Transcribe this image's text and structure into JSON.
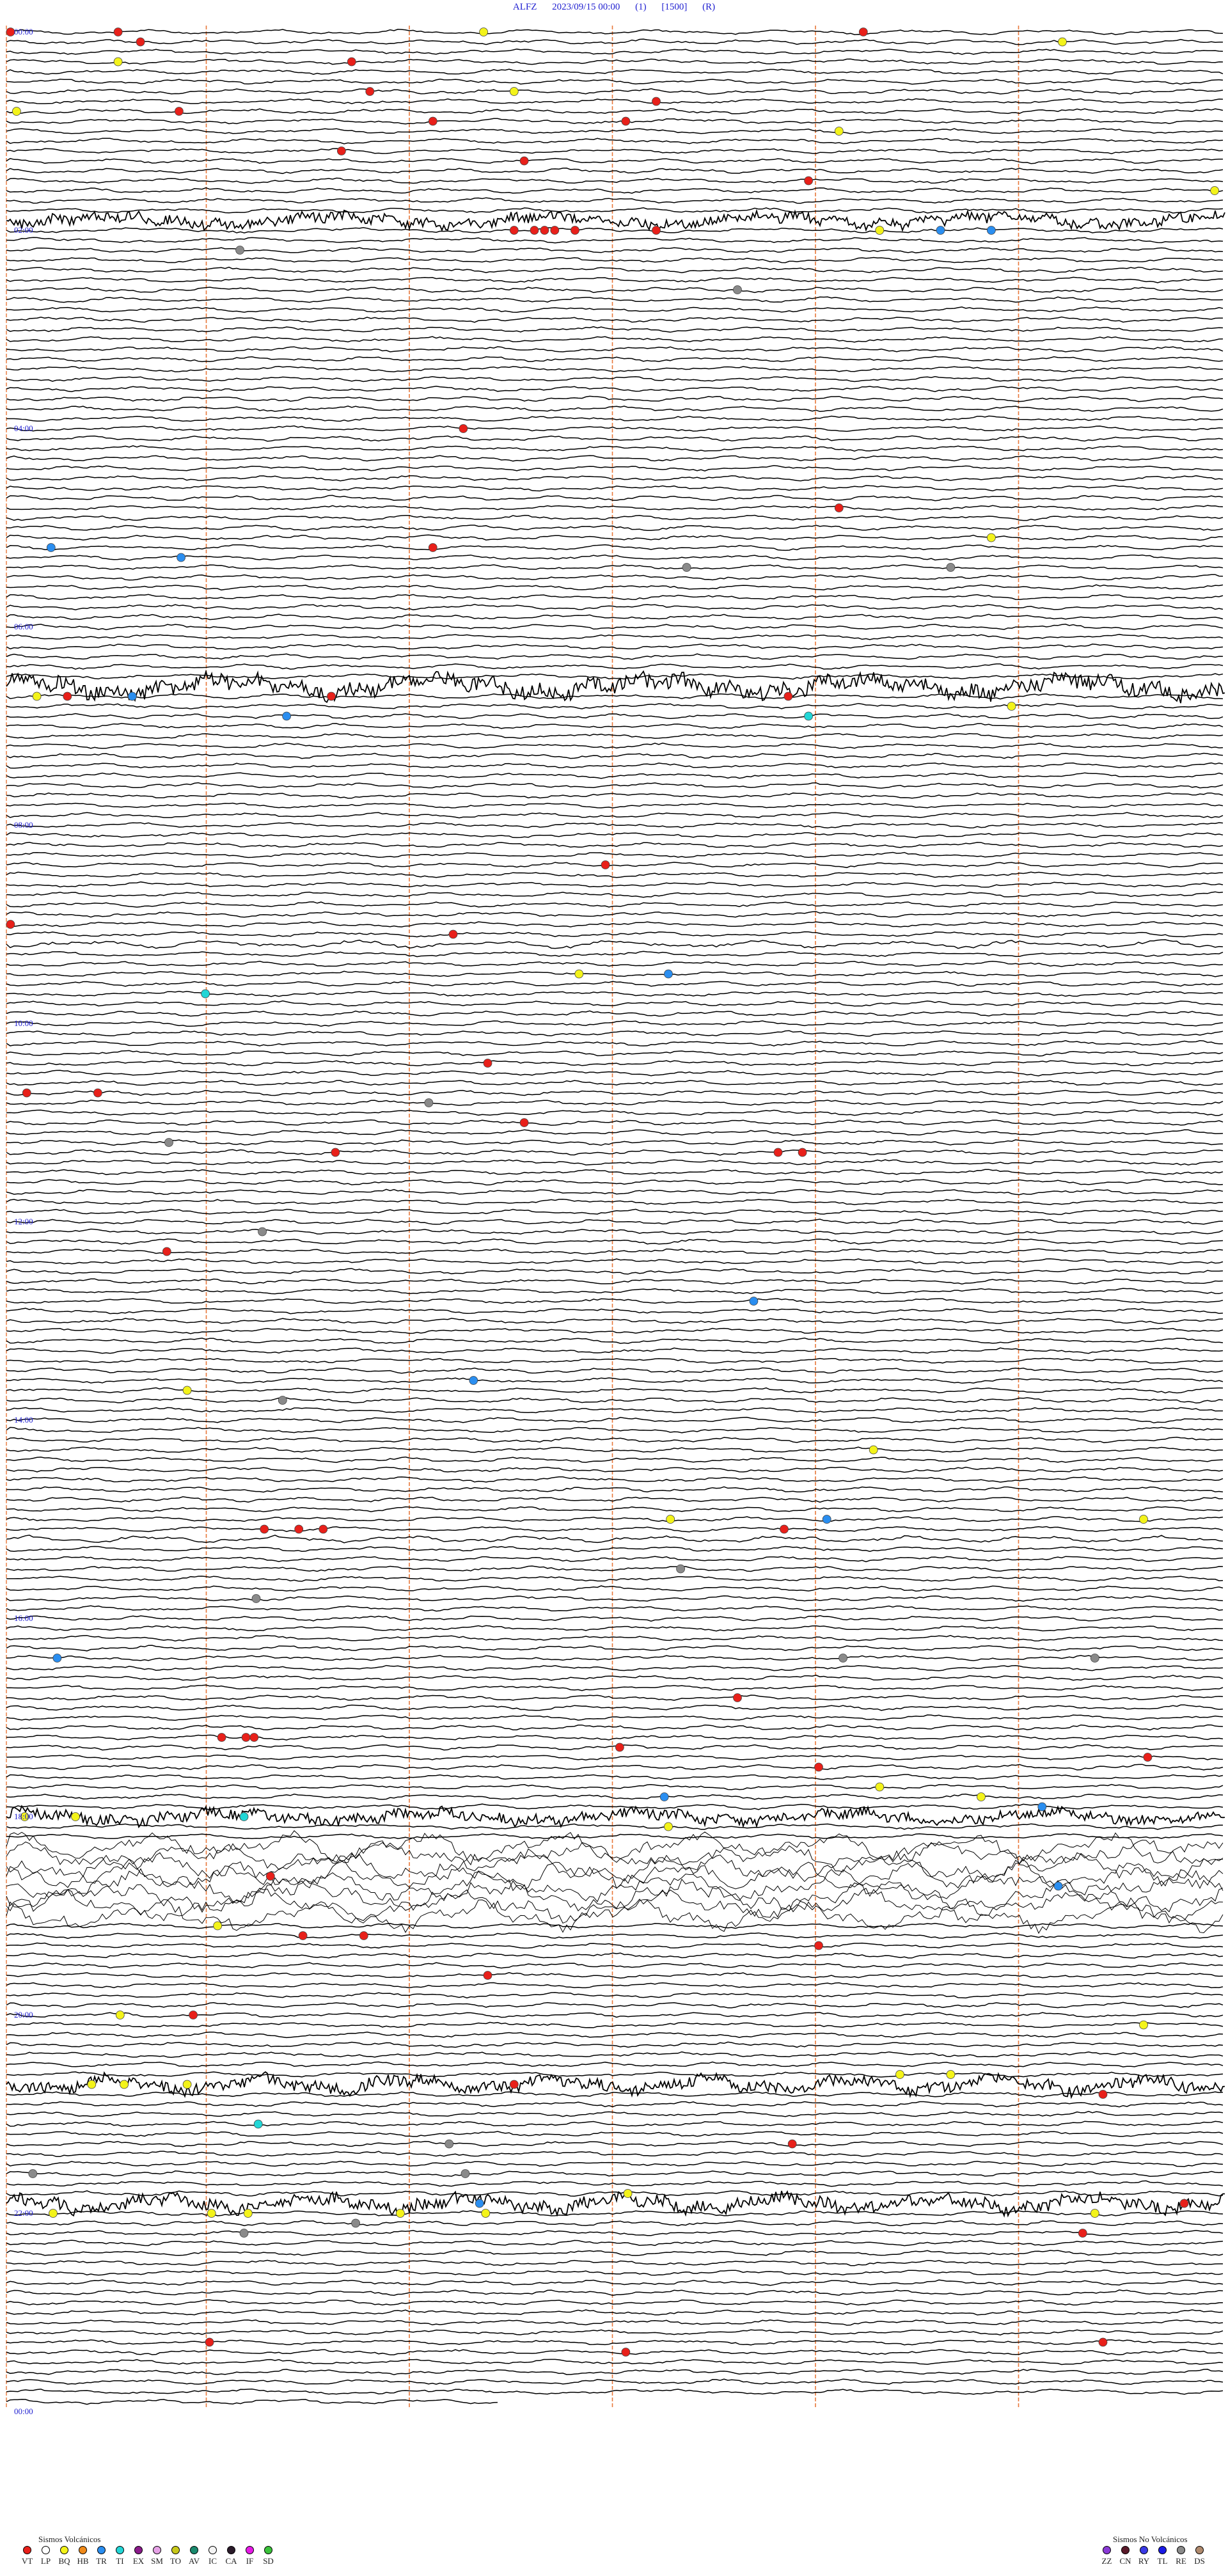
{
  "header": {
    "station": "ALFZ",
    "datetime": "2023/09/15 00:00",
    "channel": "(1)",
    "scale": "[1500]",
    "mode": "(R)"
  },
  "chart_data": {
    "type": "helicorder",
    "title": "ALFZ  2023/09/15 00:00  (1)  [1500]  (R)",
    "time_labels": [
      {
        "row": 0,
        "text": "00:00"
      },
      {
        "row": 20,
        "text": "02:00"
      },
      {
        "row": 40,
        "text": "04:00"
      },
      {
        "row": 60,
        "text": "06:00"
      },
      {
        "row": 80,
        "text": "08:00"
      },
      {
        "row": 100,
        "text": "10:00"
      },
      {
        "row": 120,
        "text": "12:00"
      },
      {
        "row": 140,
        "text": "14:00"
      },
      {
        "row": 160,
        "text": "16:00"
      },
      {
        "row": 180,
        "text": "18:00"
      },
      {
        "row": 200,
        "text": "20:00"
      },
      {
        "row": 220,
        "text": "22:00"
      },
      {
        "row": 240,
        "text": "00:00"
      }
    ],
    "rows_total": 240,
    "minutes_per_row": 6,
    "vertical_markers_minutes": [
      1,
      2,
      3,
      4,
      5
    ],
    "noisy_rows": [
      {
        "row": 19,
        "level": 3.0
      },
      {
        "row": 66,
        "level": 4.5
      },
      {
        "row": 180,
        "level": 3.0
      },
      {
        "row": 207,
        "level": 3.5
      },
      {
        "row": 219,
        "level": 3.5
      },
      {
        "row": 92,
        "level": 1.6
      },
      {
        "row": 152,
        "level": 1.4
      }
    ],
    "big_wave_rows": [
      183,
      184,
      185,
      186,
      187,
      188,
      189,
      190
    ],
    "events": [
      {
        "row": 0,
        "min": 0.02,
        "type": "VT"
      },
      {
        "row": 0,
        "min": 0.55,
        "type": "VT"
      },
      {
        "row": 0,
        "min": 2.35,
        "type": "BQ"
      },
      {
        "row": 0,
        "min": 4.22,
        "type": "VT"
      },
      {
        "row": 1,
        "min": 0.66,
        "type": "VT"
      },
      {
        "row": 1,
        "min": 5.2,
        "type": "BQ"
      },
      {
        "row": 3,
        "min": 1.7,
        "type": "VT"
      },
      {
        "row": 3,
        "min": 0.55,
        "type": "BQ"
      },
      {
        "row": 6,
        "min": 1.79,
        "type": "VT"
      },
      {
        "row": 6,
        "min": 2.5,
        "type": "BQ"
      },
      {
        "row": 7,
        "min": 3.2,
        "type": "VT"
      },
      {
        "row": 8,
        "min": 0.85,
        "type": "VT"
      },
      {
        "row": 8,
        "min": 0.05,
        "type": "BQ"
      },
      {
        "row": 9,
        "min": 2.1,
        "type": "VT"
      },
      {
        "row": 9,
        "min": 3.05,
        "type": "VT"
      },
      {
        "row": 10,
        "min": 4.1,
        "type": "BQ"
      },
      {
        "row": 12,
        "min": 1.65,
        "type": "VT"
      },
      {
        "row": 13,
        "min": 2.55,
        "type": "VT"
      },
      {
        "row": 15,
        "min": 3.95,
        "type": "VT"
      },
      {
        "row": 16,
        "min": 5.95,
        "type": "BQ"
      },
      {
        "row": 20,
        "min": 2.5,
        "type": "VT"
      },
      {
        "row": 20,
        "min": 2.6,
        "type": "VT"
      },
      {
        "row": 20,
        "min": 2.65,
        "type": "VT"
      },
      {
        "row": 20,
        "min": 2.7,
        "type": "VT"
      },
      {
        "row": 20,
        "min": 2.8,
        "type": "VT"
      },
      {
        "row": 20,
        "min": 3.2,
        "type": "VT"
      },
      {
        "row": 20,
        "min": 4.3,
        "type": "BQ"
      },
      {
        "row": 20,
        "min": 4.6,
        "type": "TR"
      },
      {
        "row": 20,
        "min": 4.85,
        "type": "TR"
      },
      {
        "row": 22,
        "min": 1.15,
        "type": "CA"
      },
      {
        "row": 26,
        "min": 3.6,
        "type": "CA"
      },
      {
        "row": 40,
        "min": 2.25,
        "type": "VT"
      },
      {
        "row": 48,
        "min": 4.1,
        "type": "VT"
      },
      {
        "row": 51,
        "min": 4.85,
        "type": "BQ"
      },
      {
        "row": 52,
        "min": 2.1,
        "type": "VT"
      },
      {
        "row": 52,
        "min": 0.22,
        "type": "TR"
      },
      {
        "row": 53,
        "min": 0.86,
        "type": "TR"
      },
      {
        "row": 54,
        "min": 3.35,
        "type": "CA"
      },
      {
        "row": 54,
        "min": 4.65,
        "type": "CA"
      },
      {
        "row": 67,
        "min": 0.3,
        "type": "VT"
      },
      {
        "row": 67,
        "min": 3.85,
        "type": "VT"
      },
      {
        "row": 67,
        "min": 0.15,
        "type": "BQ"
      },
      {
        "row": 67,
        "min": 0.62,
        "type": "TR"
      },
      {
        "row": 67,
        "min": 1.6,
        "type": "VT"
      },
      {
        "row": 68,
        "min": 4.95,
        "type": "BQ"
      },
      {
        "row": 69,
        "min": 1.38,
        "type": "TR"
      },
      {
        "row": 69,
        "min": 3.95,
        "type": "TI"
      },
      {
        "row": 84,
        "min": 2.95,
        "type": "VT"
      },
      {
        "row": 90,
        "min": 0.02,
        "type": "VT"
      },
      {
        "row": 91,
        "min": 2.2,
        "type": "VT"
      },
      {
        "row": 95,
        "min": 2.82,
        "type": "BQ"
      },
      {
        "row": 95,
        "min": 3.26,
        "type": "TR"
      },
      {
        "row": 97,
        "min": 0.98,
        "type": "TI"
      },
      {
        "row": 104,
        "min": 2.37,
        "type": "VT"
      },
      {
        "row": 107,
        "min": 0.1,
        "type": "VT"
      },
      {
        "row": 107,
        "min": 0.45,
        "type": "VT"
      },
      {
        "row": 108,
        "min": 2.08,
        "type": "CA"
      },
      {
        "row": 110,
        "min": 2.55,
        "type": "VT"
      },
      {
        "row": 112,
        "min": 0.8,
        "type": "CA"
      },
      {
        "row": 113,
        "min": 1.62,
        "type": "VT"
      },
      {
        "row": 113,
        "min": 3.8,
        "type": "VT"
      },
      {
        "row": 113,
        "min": 3.92,
        "type": "VT"
      },
      {
        "row": 121,
        "min": 1.26,
        "type": "CA"
      },
      {
        "row": 123,
        "min": 0.79,
        "type": "VT"
      },
      {
        "row": 128,
        "min": 3.68,
        "type": "TR"
      },
      {
        "row": 136,
        "min": 2.3,
        "type": "TR"
      },
      {
        "row": 137,
        "min": 0.89,
        "type": "BQ"
      },
      {
        "row": 138,
        "min": 1.36,
        "type": "CA"
      },
      {
        "row": 143,
        "min": 4.27,
        "type": "BQ"
      },
      {
        "row": 150,
        "min": 3.27,
        "type": "BQ"
      },
      {
        "row": 150,
        "min": 4.04,
        "type": "TR"
      },
      {
        "row": 150,
        "min": 5.6,
        "type": "BQ"
      },
      {
        "row": 151,
        "min": 1.27,
        "type": "VT"
      },
      {
        "row": 151,
        "min": 1.44,
        "type": "VT"
      },
      {
        "row": 151,
        "min": 1.56,
        "type": "VT"
      },
      {
        "row": 151,
        "min": 3.83,
        "type": "VT"
      },
      {
        "row": 155,
        "min": 3.32,
        "type": "CA"
      },
      {
        "row": 158,
        "min": 1.23,
        "type": "CA"
      },
      {
        "row": 164,
        "min": 0.25,
        "type": "TR"
      },
      {
        "row": 164,
        "min": 4.12,
        "type": "CA"
      },
      {
        "row": 164,
        "min": 5.36,
        "type": "CA"
      },
      {
        "row": 168,
        "min": 3.6,
        "type": "VT"
      },
      {
        "row": 172,
        "min": 1.06,
        "type": "VT"
      },
      {
        "row": 172,
        "min": 1.18,
        "type": "VT"
      },
      {
        "row": 172,
        "min": 1.22,
        "type": "VT"
      },
      {
        "row": 173,
        "min": 3.02,
        "type": "VT"
      },
      {
        "row": 174,
        "min": 5.62,
        "type": "VT"
      },
      {
        "row": 175,
        "min": 4.0,
        "type": "VT"
      },
      {
        "row": 177,
        "min": 4.3,
        "type": "BQ"
      },
      {
        "row": 178,
        "min": 3.24,
        "type": "TR"
      },
      {
        "row": 178,
        "min": 4.8,
        "type": "BQ"
      },
      {
        "row": 179,
        "min": 5.1,
        "type": "TR"
      },
      {
        "row": 180,
        "min": 0.09,
        "type": "BQ"
      },
      {
        "row": 180,
        "min": 0.34,
        "type": "BQ"
      },
      {
        "row": 180,
        "min": 1.17,
        "type": "TI"
      },
      {
        "row": 181,
        "min": 3.26,
        "type": "BQ"
      },
      {
        "row": 186,
        "min": 1.3,
        "type": "VT"
      },
      {
        "row": 187,
        "min": 5.18,
        "type": "TR"
      },
      {
        "row": 191,
        "min": 1.04,
        "type": "BQ"
      },
      {
        "row": 192,
        "min": 1.46,
        "type": "VT"
      },
      {
        "row": 192,
        "min": 1.76,
        "type": "VT"
      },
      {
        "row": 193,
        "min": 4.0,
        "type": "VT"
      },
      {
        "row": 196,
        "min": 2.37,
        "type": "VT"
      },
      {
        "row": 200,
        "min": 0.56,
        "type": "BQ"
      },
      {
        "row": 200,
        "min": 0.92,
        "type": "VT"
      },
      {
        "row": 201,
        "min": 5.6,
        "type": "BQ"
      },
      {
        "row": 206,
        "min": 4.4,
        "type": "BQ"
      },
      {
        "row": 206,
        "min": 4.65,
        "type": "BQ"
      },
      {
        "row": 207,
        "min": 0.42,
        "type": "BQ"
      },
      {
        "row": 207,
        "min": 0.58,
        "type": "BQ"
      },
      {
        "row": 207,
        "min": 0.89,
        "type": "BQ"
      },
      {
        "row": 207,
        "min": 2.5,
        "type": "VT"
      },
      {
        "row": 208,
        "min": 5.4,
        "type": "VT"
      },
      {
        "row": 211,
        "min": 1.24,
        "type": "TI"
      },
      {
        "row": 213,
        "min": 2.18,
        "type": "CA"
      },
      {
        "row": 213,
        "min": 3.87,
        "type": "VT"
      },
      {
        "row": 216,
        "min": 0.13,
        "type": "CA"
      },
      {
        "row": 216,
        "min": 2.26,
        "type": "CA"
      },
      {
        "row": 218,
        "min": 3.06,
        "type": "BQ"
      },
      {
        "row": 219,
        "min": 2.33,
        "type": "TR"
      },
      {
        "row": 219,
        "min": 5.8,
        "type": "VT"
      },
      {
        "row": 220,
        "min": 0.23,
        "type": "BQ"
      },
      {
        "row": 220,
        "min": 1.01,
        "type": "BQ"
      },
      {
        "row": 220,
        "min": 1.19,
        "type": "BQ"
      },
      {
        "row": 220,
        "min": 1.94,
        "type": "BQ"
      },
      {
        "row": 220,
        "min": 2.36,
        "type": "BQ"
      },
      {
        "row": 220,
        "min": 5.36,
        "type": "BQ"
      },
      {
        "row": 221,
        "min": 1.72,
        "type": "CA"
      },
      {
        "row": 222,
        "min": 1.17,
        "type": "CA"
      },
      {
        "row": 222,
        "min": 5.3,
        "type": "VT"
      },
      {
        "row": 233,
        "min": 1.0,
        "type": "VT"
      },
      {
        "row": 233,
        "min": 5.4,
        "type": "VT"
      },
      {
        "row": 234,
        "min": 3.05,
        "type": "VT"
      }
    ]
  },
  "legend": {
    "volcanic_title": "Sismos Volcánicos",
    "volcanic": [
      {
        "code": "VT",
        "color": "#e8201a"
      },
      {
        "code": "LP",
        "color": "#ffffff"
      },
      {
        "code": "BQ",
        "color": "#f3f31a"
      },
      {
        "code": "HB",
        "color": "#f08a1a"
      },
      {
        "code": "TR",
        "color": "#2a8ef0"
      },
      {
        "code": "TI",
        "color": "#22d6d6"
      },
      {
        "code": "EX",
        "color": "#8a1a8a"
      },
      {
        "code": "SM",
        "color": "#e6a2e6"
      },
      {
        "code": "TO",
        "color": "#c8c81a"
      },
      {
        "code": "AV",
        "color": "#1a8a6e"
      },
      {
        "code": "IC",
        "color": "#f4f4f4"
      },
      {
        "code": "CA",
        "color": "#2a1a2a"
      },
      {
        "code": "IF",
        "color": "#e61ae6"
      },
      {
        "code": "SD",
        "color": "#3ac23a"
      }
    ],
    "nonvolcanic_title": "Sismos No Volcánicos",
    "nonvolcanic": [
      {
        "code": "ZZ",
        "color": "#8a3ad6"
      },
      {
        "code": "CN",
        "color": "#5a1a2a"
      },
      {
        "code": "RY",
        "color": "#3a3ae6"
      },
      {
        "code": "TL",
        "color": "#1a1ae6"
      },
      {
        "code": "RE",
        "color": "#8a8a8a"
      },
      {
        "code": "DS",
        "color": "#b08a6e"
      }
    ],
    "event_colors": {
      "VT": "#e8201a",
      "BQ": "#f3f31a",
      "TR": "#2a8ef0",
      "TI": "#22d6d6",
      "CA": "#8a8a8a"
    },
    "trace_color": "#000000",
    "time_label_color": "#1f1fd0",
    "marker_color": "#e8783a"
  }
}
